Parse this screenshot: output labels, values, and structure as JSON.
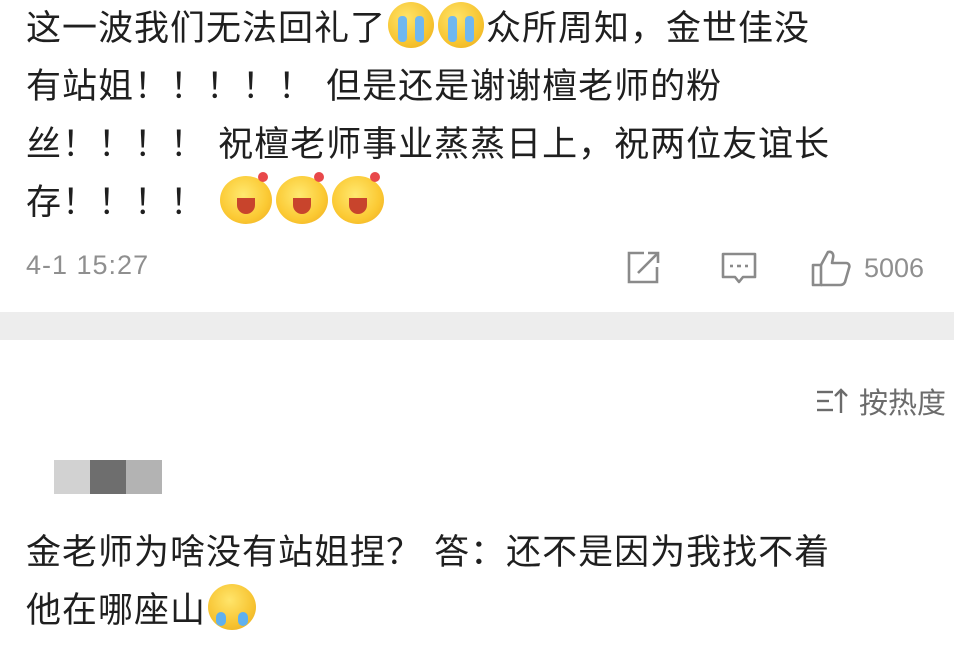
{
  "post": {
    "line1_a": "这一波我们无法回礼了",
    "line1_b": "众所周知，金世佳没",
    "line2": "有站姐！！！！！ 但是还是谢谢檀老师的粉",
    "line3": "丝！！！！ 祝檀老师事业蒸蒸日上，祝两位友谊长",
    "line4": "存！！！！",
    "timestamp": "4-1 15:27",
    "like_count": "5006"
  },
  "sort": {
    "label": "按热度"
  },
  "reply": {
    "line1": "金老师为啥没有站姐捏？ 答：还不是因为我找不着",
    "line2": "他在哪座山"
  },
  "icons": {
    "share": "share-edit-icon",
    "comment": "comment-icon",
    "like": "thumbs-up-icon",
    "sort": "sort-icon"
  },
  "colors": {
    "text": "#1f1f1f",
    "meta": "#8f8f8f",
    "divider": "#ededed"
  }
}
